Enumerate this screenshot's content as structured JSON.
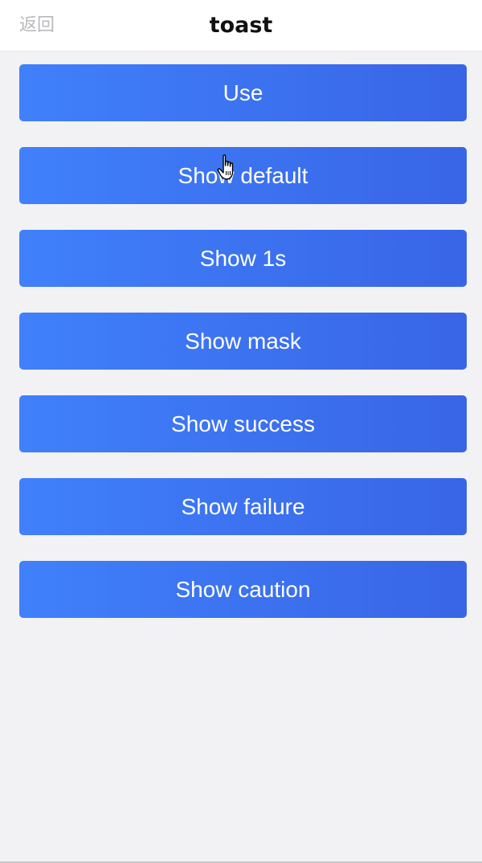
{
  "nav": {
    "back_label": "返回",
    "title": "toast"
  },
  "buttons": [
    {
      "label": "Use"
    },
    {
      "label": "Show default"
    },
    {
      "label": "Show 1s"
    },
    {
      "label": "Show mask"
    },
    {
      "label": "Show success"
    },
    {
      "label": "Show failure"
    },
    {
      "label": "Show caution"
    }
  ],
  "colors": {
    "button_gradient_start": "#4080fb",
    "button_gradient_end": "#3865e6",
    "background": "#f2f2f4"
  },
  "cursor": {
    "icon": "hand-pointer-icon"
  }
}
